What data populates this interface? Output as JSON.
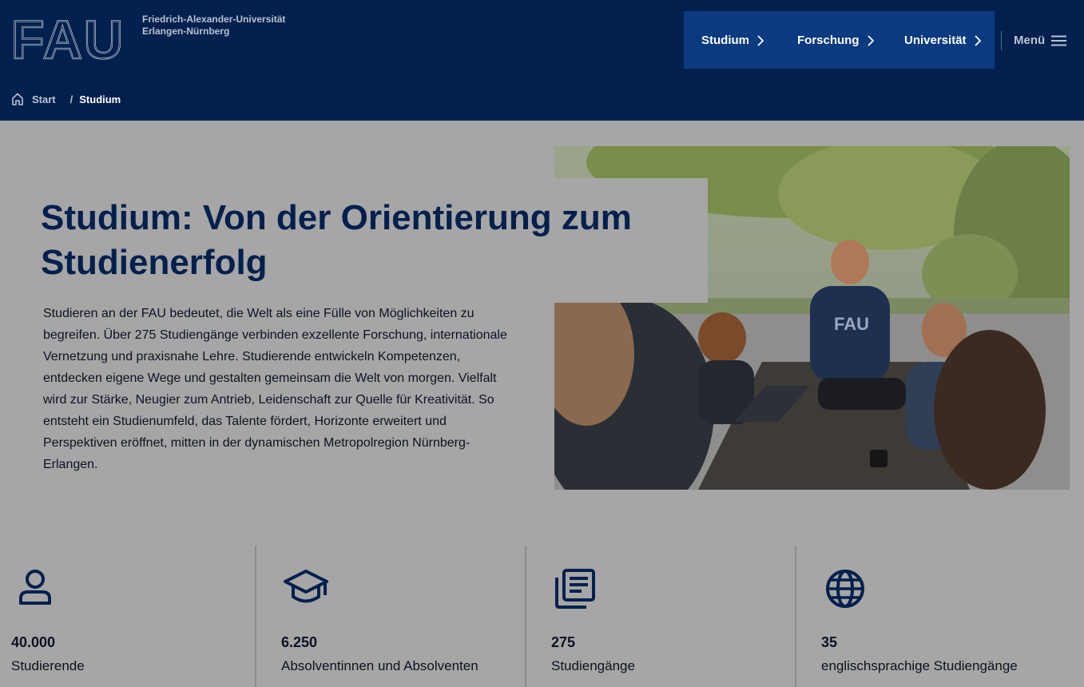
{
  "header": {
    "logo_text": "FAU",
    "university_line1": "Friedrich-Alexander-Universität",
    "university_line2": "Erlangen-Nürnberg",
    "nav": [
      {
        "label": "Studium"
      },
      {
        "label": "Forschung"
      },
      {
        "label": "Universität"
      }
    ],
    "menu_label": "Menü"
  },
  "breadcrumb": {
    "home": "Start",
    "separator": "/",
    "current": "Studium"
  },
  "hero": {
    "title": "Studium: Von der Orientierung zum Studienerfolg",
    "intro": "Studieren an der FAU bedeutet, die Welt als eine Fülle von Möglichkeiten zu begreifen. Über 275 Studiengänge verbinden exzellente Forschung, internationale Vernetzung und praxisnahe Lehre. Studierende entwickeln Kompetenzen, entdecken eigene Wege und gestalten gemeinsam die Welt von morgen. Vielfalt wird zur Stärke, Neugier zum Antrieb, Leidenschaft zur Quelle für Kreativität. So entsteht ein Studienumfeld, das Talente fördert, Horizonte erweitert und Perspektiven eröffnet, mitten in der dynamischen Metropolregion Nürnberg-Erlangen.",
    "image_hoodie_text": "FAU"
  },
  "stats": [
    {
      "icon": "person-icon",
      "value": "40.000",
      "label": "Studierende"
    },
    {
      "icon": "graduation-cap-icon",
      "value": "6.250",
      "label": "Absolventinnen und Absolventen"
    },
    {
      "icon": "document-list-icon",
      "value": "275",
      "label": "Studiengänge"
    },
    {
      "icon": "globe-icon",
      "value": "35",
      "label": "englischsprachige Studiengänge"
    }
  ],
  "colors": {
    "header_bg": "#02204d",
    "nav_bg": "#0a3a7f",
    "page_bg": "#a6a6a6",
    "title": "#02204d"
  }
}
